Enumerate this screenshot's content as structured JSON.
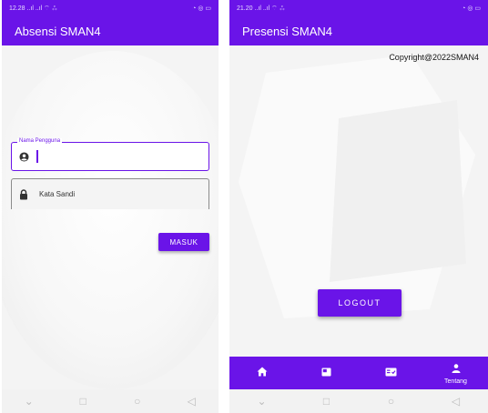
{
  "left_screen": {
    "status_bar": {
      "time": "12.28",
      "signal": "..ıl ..ıl ⌔ ⁂",
      "right_icons": "◔ ◎ ▭"
    },
    "app_title": "Absensi SMAN4",
    "username_field": {
      "label": "Nama Pengguna",
      "value": "",
      "icon": "user-circle-icon"
    },
    "password_field": {
      "placeholder": "Kata Sandi",
      "icon": "lock-icon"
    },
    "login_button": "MASUK"
  },
  "right_screen": {
    "status_bar": {
      "time": "21.20",
      "signal": "..ıl ..ıl ⌔ ⁂",
      "right_icons": "◔ ◎ ▭"
    },
    "app_title": "Presensi SMAN4",
    "copyright": "Copyright@2022SMAN4",
    "logout_button": "LOGOUT",
    "bottom_nav": [
      {
        "icon": "home-icon",
        "label": ""
      },
      {
        "icon": "image-icon",
        "label": ""
      },
      {
        "icon": "id-card-icon",
        "label": ""
      },
      {
        "icon": "person-icon",
        "label": "Tentang"
      }
    ]
  },
  "system_nav": {
    "back": "⌄",
    "recents": "□",
    "home": "○",
    "back_triangle": "◁"
  },
  "colors": {
    "primary": "#6a14e8",
    "background": "#f4f4f4"
  }
}
